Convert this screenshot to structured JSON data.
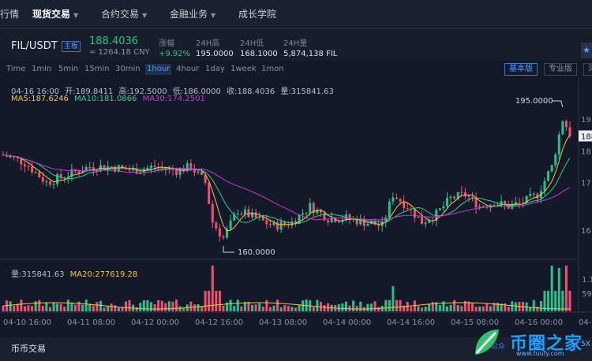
{
  "nav": [
    {
      "label": "行情",
      "caret": false,
      "active": false
    },
    {
      "label": "现货交易",
      "caret": true,
      "active": true
    },
    {
      "label": "合约交易",
      "caret": true,
      "active": false
    },
    {
      "label": "金融业务",
      "caret": true,
      "active": false
    },
    {
      "label": "成长学院",
      "caret": false,
      "active": false
    }
  ],
  "ticker": {
    "symbol": "FIL/USDT",
    "badge": "主板",
    "price": "188.4036",
    "cny": "≈ 1264.18 CNY",
    "stats": [
      {
        "label": "涨幅",
        "value": "+9.92%"
      },
      {
        "label": "24H高",
        "value": "195.0000"
      },
      {
        "label": "24H低",
        "value": "168.1000"
      },
      {
        "label": "24H量",
        "value": "5,874,138 FIL"
      }
    ],
    "star": "★"
  },
  "timeframes": [
    "Time",
    "1min",
    "5min",
    "15min",
    "30min",
    "1hour",
    "4hour",
    "1day",
    "1week",
    "1mon"
  ],
  "active_timeframe": "1hour",
  "views": [
    "基本版",
    "专业版",
    "深"
  ],
  "ohlc": {
    "date": "04-16 16:00",
    "open": "开:189.8411",
    "high": "高:192.5000",
    "low": "低:186.0000",
    "close": "收:188.4036",
    "vol": "量:315841.63"
  },
  "ma": {
    "ma5": "MA5:187.6246",
    "ma10": "MA10:181.0866",
    "ma30": "MA30:174.2501"
  },
  "vol_info": {
    "vol": "量:315841.63",
    "ma20": "MA20:277619.28"
  },
  "max_label": "195.0000",
  "min_label": "160.0000",
  "price_axis": [
    {
      "label": "19",
      "value": 192
    },
    {
      "label": "18",
      "value": 184
    },
    {
      "label": "17",
      "value": 176
    },
    {
      "label": "16",
      "value": 164
    }
  ],
  "current_price_tag": "188",
  "vol_axis": [
    {
      "label": "1.1"
    },
    {
      "label": "59"
    }
  ],
  "x_labels": [
    "04-10 16:00",
    "04-11 08:00",
    "04-12 00:00",
    "04-12 16:00",
    "04-13 08:00",
    "04-14 00:00",
    "04-14 16:00",
    "04-15 08:00",
    "04-16 00:00",
    "04-1"
  ],
  "bottom_tab": "币币交易",
  "watermark": {
    "text": "币圈之家",
    "url": "www.tuufy.com",
    "left": "公众",
    "right": "5X"
  },
  "colors": {
    "up": "#27c28c",
    "down": "#f0506e",
    "ma5": "#f2c744",
    "ma10": "#2fd08a",
    "ma30": "#c23cc8",
    "accent": "#3b9cff"
  },
  "chart_data": {
    "type": "candlestick",
    "keypoints": [
      {
        "idx": 0,
        "price": 183
      },
      {
        "idx": 6,
        "price": 181
      },
      {
        "idx": 12,
        "price": 176
      },
      {
        "idx": 18,
        "price": 178
      },
      {
        "idx": 24,
        "price": 180
      },
      {
        "idx": 30,
        "price": 180
      },
      {
        "idx": 36,
        "price": 179
      },
      {
        "idx": 42,
        "price": 180
      },
      {
        "idx": 48,
        "price": 179
      },
      {
        "idx": 52,
        "price": 180
      },
      {
        "idx": 56,
        "price": 176
      },
      {
        "idx": 58,
        "price": 166
      },
      {
        "idx": 61,
        "price": 162
      },
      {
        "idx": 65,
        "price": 169
      },
      {
        "idx": 70,
        "price": 167
      },
      {
        "idx": 75,
        "price": 165
      },
      {
        "idx": 80,
        "price": 166
      },
      {
        "idx": 85,
        "price": 170
      },
      {
        "idx": 90,
        "price": 167
      },
      {
        "idx": 95,
        "price": 167
      },
      {
        "idx": 100,
        "price": 166
      },
      {
        "idx": 105,
        "price": 165
      },
      {
        "idx": 108,
        "price": 173
      },
      {
        "idx": 112,
        "price": 170
      },
      {
        "idx": 116,
        "price": 166
      },
      {
        "idx": 120,
        "price": 168
      },
      {
        "idx": 124,
        "price": 172
      },
      {
        "idx": 128,
        "price": 173
      },
      {
        "idx": 132,
        "price": 170
      },
      {
        "idx": 136,
        "price": 171
      },
      {
        "idx": 140,
        "price": 170
      },
      {
        "idx": 144,
        "price": 171
      },
      {
        "idx": 148,
        "price": 173
      },
      {
        "idx": 152,
        "price": 180
      },
      {
        "idx": 155,
        "price": 192
      },
      {
        "idx": 157,
        "price": 188.4
      }
    ],
    "count": 158,
    "max_price": 195.0,
    "min_price": 160.0,
    "volume_peaks": [
      {
        "idx": 58,
        "vol": 1.0
      },
      {
        "idx": 108,
        "vol": 0.55
      },
      {
        "idx": 152,
        "vol": 1.0
      },
      {
        "idx": 154,
        "vol": 0.95
      },
      {
        "idx": 156,
        "vol": 1.0
      }
    ]
  }
}
